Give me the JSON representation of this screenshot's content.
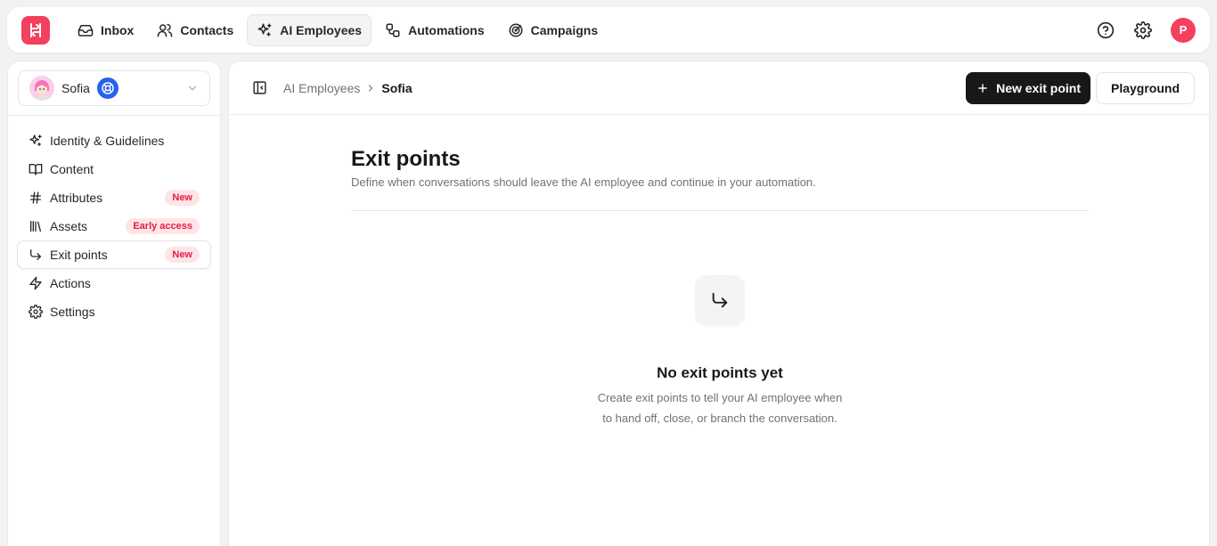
{
  "topbar": {
    "nav": [
      {
        "label": "Inbox",
        "icon": "inbox-icon"
      },
      {
        "label": "Contacts",
        "icon": "users-icon"
      },
      {
        "label": "AI Employees",
        "icon": "sparkles-icon",
        "active": true
      },
      {
        "label": "Automations",
        "icon": "workflow-icon"
      },
      {
        "label": "Campaigns",
        "icon": "target-icon"
      }
    ],
    "user_initial": "P"
  },
  "sidebar": {
    "employee_name": "Sofia",
    "items": [
      {
        "label": "Identity & Guidelines",
        "icon": "sparkles-icon"
      },
      {
        "label": "Content",
        "icon": "book-icon"
      },
      {
        "label": "Attributes",
        "icon": "hash-icon",
        "badge": "New"
      },
      {
        "label": "Assets",
        "icon": "library-icon",
        "badge": "Early access"
      },
      {
        "label": "Exit points",
        "icon": "corner-down-right-icon",
        "badge": "New",
        "active": true
      },
      {
        "label": "Actions",
        "icon": "zap-icon"
      },
      {
        "label": "Settings",
        "icon": "gear-icon"
      }
    ]
  },
  "main": {
    "breadcrumb": {
      "parent": "AI Employees",
      "current": "Sofia"
    },
    "new_button": "New exit point",
    "playground_button": "Playground",
    "title": "Exit points",
    "subtitle": "Define when conversations should leave the AI employee and continue in your automation.",
    "empty": {
      "title": "No exit points yet",
      "line1": "Create exit points to tell your AI employee when",
      "line2": "to hand off, close, or branch the conversation."
    }
  },
  "colors": {
    "brand": "#f43f5e",
    "badge_bg": "#ffe4e6",
    "badge_text": "#e11d48",
    "primary_button": "#18181b"
  }
}
